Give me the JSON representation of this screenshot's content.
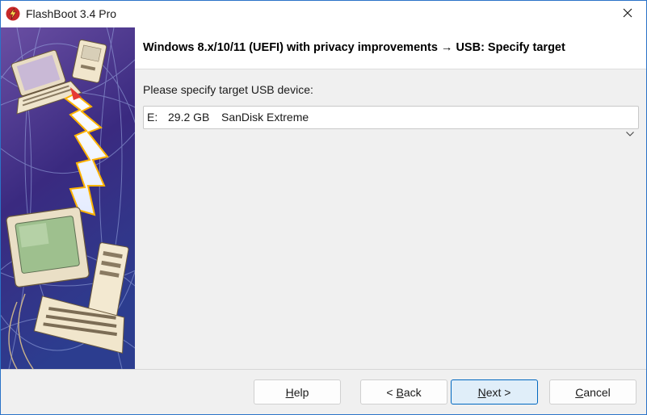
{
  "window": {
    "title": "FlashBoot 3.4 Pro",
    "icon": "flashboot-app-icon",
    "close_icon": "close-icon"
  },
  "header": {
    "title": "Windows 8.x/10/11 (UEFI) with privacy improvements → USB: Specify target"
  },
  "main": {
    "prompt": "Please specify target USB device:",
    "target_device": {
      "drive": "E:",
      "size": "29.2 GB",
      "name": "SanDisk Extreme"
    }
  },
  "buttons": {
    "help": {
      "hotkey": "H",
      "rest": "elp"
    },
    "back": {
      "prefix": "< ",
      "hotkey": "B",
      "rest": "ack"
    },
    "next": {
      "hotkey": "N",
      "rest": "ext >"
    },
    "cancel": {
      "hotkey": "C",
      "rest": "ancel"
    }
  },
  "colors": {
    "accent": "#0067c0",
    "window_border": "#2b73c8",
    "dialog_background": "#f0f0f0"
  }
}
